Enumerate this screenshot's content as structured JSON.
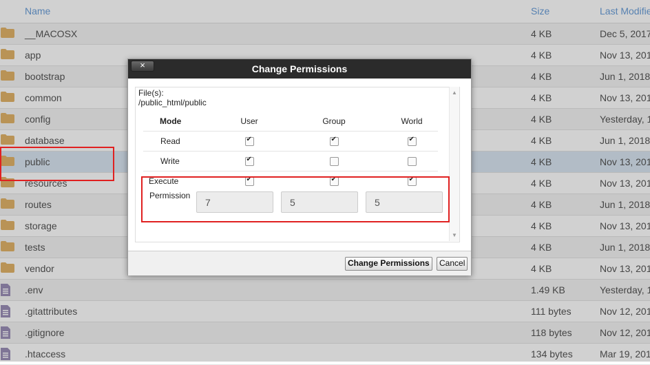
{
  "header": {
    "name": "Name",
    "size": "Size",
    "modified": "Last Modifie"
  },
  "rows": [
    {
      "name": "__MACOSX",
      "size": "4 KB",
      "modified": "Dec 5, 2017",
      "type": "folder"
    },
    {
      "name": "app",
      "size": "4 KB",
      "modified": "Nov 13, 201",
      "type": "folder"
    },
    {
      "name": "bootstrap",
      "size": "4 KB",
      "modified": "Jun 1, 2018",
      "type": "folder"
    },
    {
      "name": "common",
      "size": "4 KB",
      "modified": "Nov 13, 201",
      "type": "folder"
    },
    {
      "name": "config",
      "size": "4 KB",
      "modified": "Yesterday, 1",
      "type": "folder"
    },
    {
      "name": "database",
      "size": "4 KB",
      "modified": "Jun 1, 2018",
      "type": "folder"
    },
    {
      "name": "public",
      "size": "4 KB",
      "modified": "Nov 13, 201",
      "type": "folder",
      "selected": true
    },
    {
      "name": "resources",
      "size": "4 KB",
      "modified": "Nov 13, 201",
      "type": "folder"
    },
    {
      "name": "routes",
      "size": "4 KB",
      "modified": "Jun 1, 2018",
      "type": "folder"
    },
    {
      "name": "storage",
      "size": "4 KB",
      "modified": "Nov 13, 201",
      "type": "folder"
    },
    {
      "name": "tests",
      "size": "4 KB",
      "modified": "Jun 1, 2018",
      "type": "folder"
    },
    {
      "name": "vendor",
      "size": "4 KB",
      "modified": "Nov 13, 201",
      "type": "folder"
    },
    {
      "name": ".env",
      "size": "1.49 KB",
      "modified": "Yesterday, 1",
      "type": "file"
    },
    {
      "name": ".gitattributes",
      "size": "111 bytes",
      "modified": "Nov 12, 201",
      "type": "file"
    },
    {
      "name": ".gitignore",
      "size": "118 bytes",
      "modified": "Nov 12, 201",
      "type": "file"
    },
    {
      "name": ".htaccess",
      "size": "134 bytes",
      "modified": "Mar 19, 201",
      "type": "file"
    }
  ],
  "icons": {
    "folder": "folder-icon",
    "file": "file-text-icon",
    "close": "close-icon"
  },
  "colors": {
    "folder": "#e2b46a",
    "file": "#9b8fb8",
    "header_link": "#6a9ed8",
    "title_bar": "#2b2b2b",
    "highlight": "#e02020",
    "selected_row": "#d9e6f2"
  },
  "dialog": {
    "title": "Change Permissions",
    "close_label": "×",
    "files_label": "File(s):",
    "files_path": "/public_html/public",
    "columns": {
      "mode": "Mode",
      "user": "User",
      "group": "Group",
      "world": "World"
    },
    "perms": [
      {
        "label": "Read",
        "user": true,
        "group": true,
        "world": true
      },
      {
        "label": "Write",
        "user": true,
        "group": false,
        "world": false
      },
      {
        "label": "Execute",
        "user": true,
        "group": true,
        "world": true
      }
    ],
    "permission_label": "Permission",
    "permission_values": {
      "user": "7",
      "group": "5",
      "world": "5"
    },
    "buttons": {
      "change": "Change Permissions",
      "cancel": "Cancel"
    }
  }
}
